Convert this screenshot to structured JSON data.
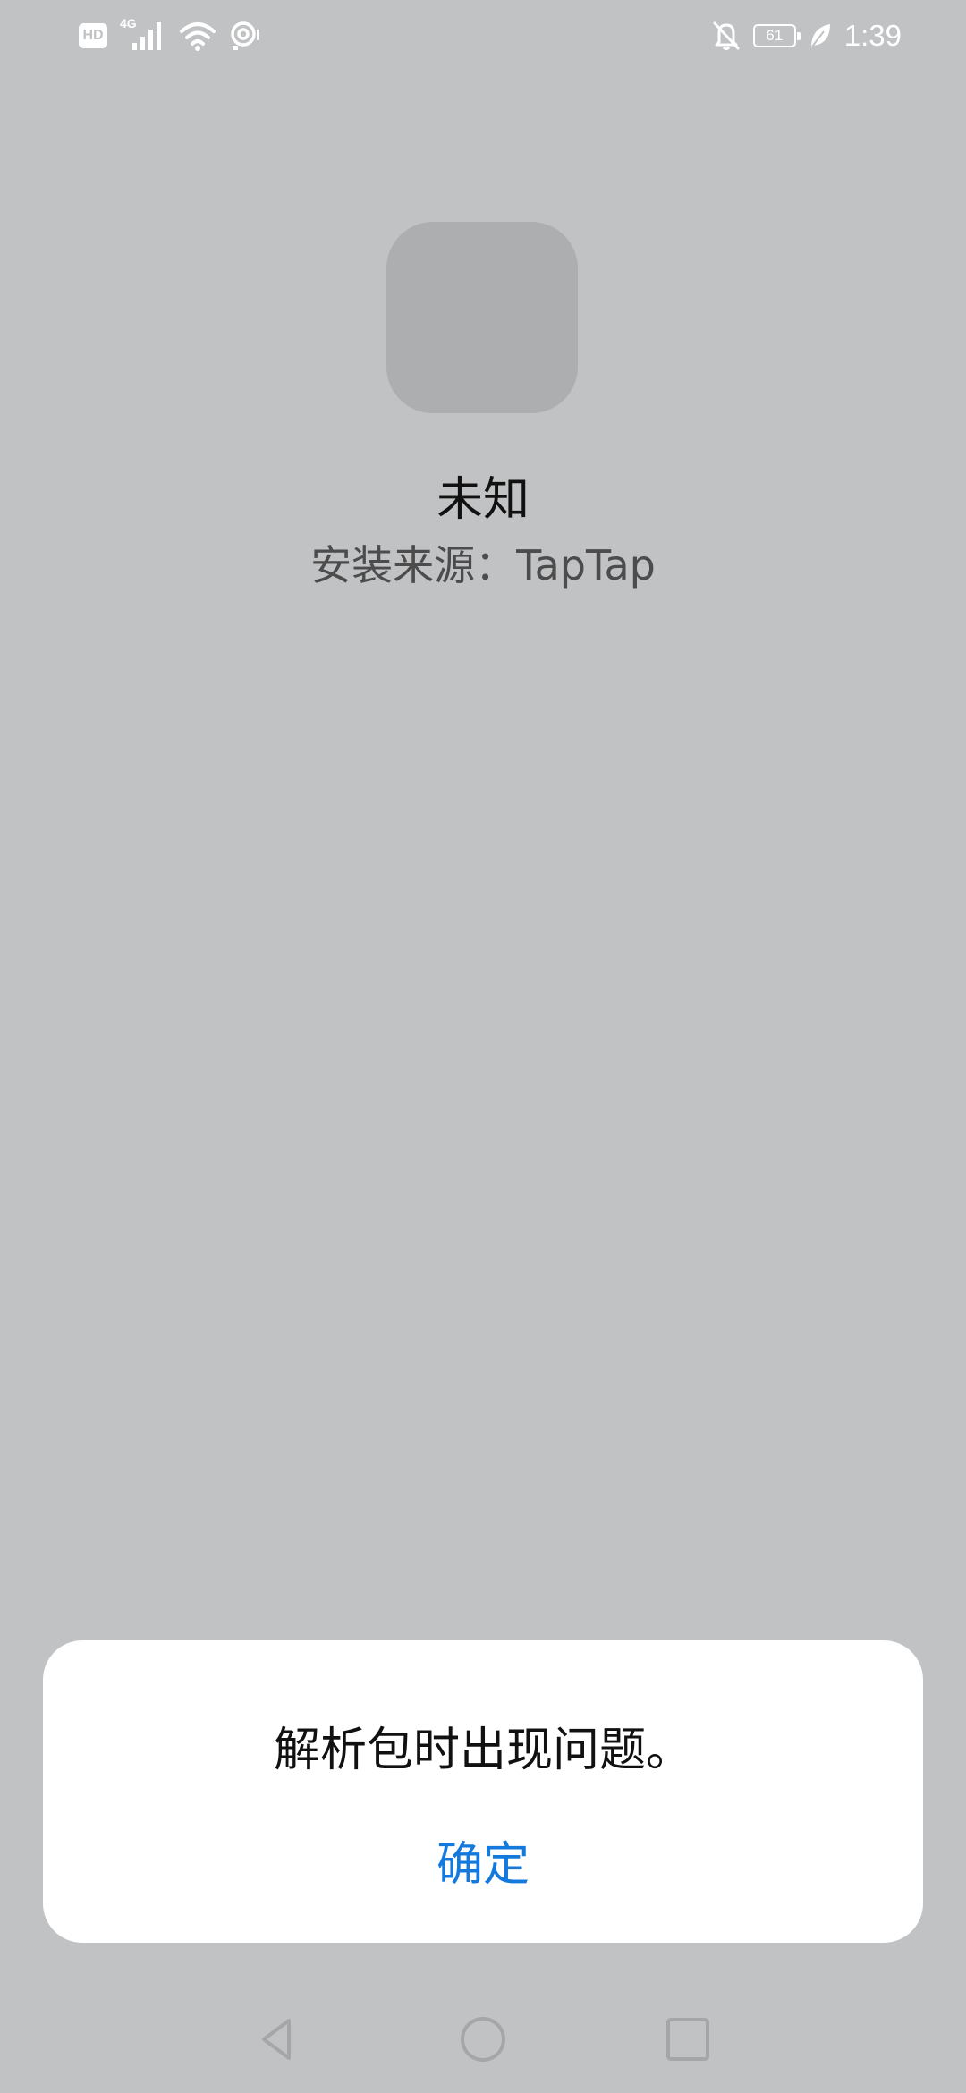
{
  "status_bar": {
    "hd_label": "HD",
    "network_label": "4G",
    "battery_level": "61",
    "time": "1:39",
    "icons": [
      "hd-icon",
      "signal-icon",
      "wifi-icon",
      "hotspot-icon",
      "bell-off-icon",
      "battery-icon",
      "leaf-icon"
    ]
  },
  "app": {
    "name": "未知",
    "source": "安装来源：TapTap"
  },
  "dialog": {
    "message": "解析包时出现问题。",
    "confirm_label": "确定",
    "accent_color": "#1479dd"
  },
  "nav_bar": {
    "icons": [
      "back-icon",
      "home-icon",
      "recents-icon"
    ]
  }
}
